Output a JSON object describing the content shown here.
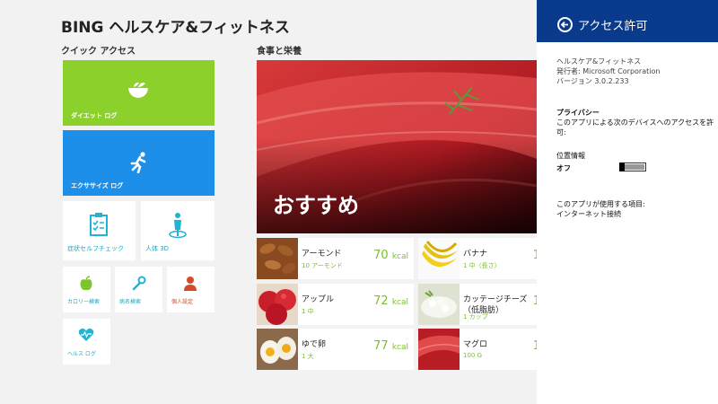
{
  "app": {
    "title": "BING ヘルスケア&フィットネス"
  },
  "quick_access": {
    "heading": "クイック アクセス",
    "diet_log": "ダイエット ログ",
    "exercise_log": "エクササイズ ログ",
    "symptom_check": "症状セルフチェック",
    "body_3d": "人体 3D",
    "calorie_search": "カロリー検索",
    "disease_search": "病名検索",
    "personal_settings": "個人設定",
    "health_log": "ヘルス ログ"
  },
  "nutrition": {
    "heading": "食事と栄養",
    "hero_text": "おすすめ",
    "foods": [
      {
        "name": "アーモンド",
        "qty": "10 アーモンド",
        "cal": "70",
        "unit": "kcal"
      },
      {
        "name": "バナナ",
        "qty": "1 中（長さ）",
        "cal": "1"
      },
      {
        "name": "アップル",
        "qty": "1 中",
        "cal": "72",
        "unit": "kcal"
      },
      {
        "name": "カッテージチーズ",
        "name2": "（低脂肪）",
        "qty": "1 カップ",
        "cal": "1"
      },
      {
        "name": "ゆで卵",
        "qty": "1 大",
        "cal": "77",
        "unit": "kcal"
      },
      {
        "name": "マグロ",
        "qty": "100 G",
        "cal": "1"
      }
    ]
  },
  "permissions_panel": {
    "title": "アクセス許可",
    "app_name": "ヘルスケア&フィットネス",
    "publisher": "発行者: Microsoft Corporation",
    "version": "バージョン 3.0.2.233",
    "privacy_heading": "プライバシー",
    "privacy_text_1": "このアプリによる次のデバイスへのアクセスを許",
    "privacy_text_2": "可:",
    "location_label": "位置情報",
    "location_state": "オフ",
    "location_enabled": false,
    "uses_heading": "このアプリが使用する項目:",
    "uses_item": "インターネット接続"
  },
  "colors": {
    "diet_tile": "#8cd12b",
    "exercise_tile": "#1e8fe8",
    "panel_header": "#0a3a8c",
    "calorie_green": "#7cbf2a"
  }
}
